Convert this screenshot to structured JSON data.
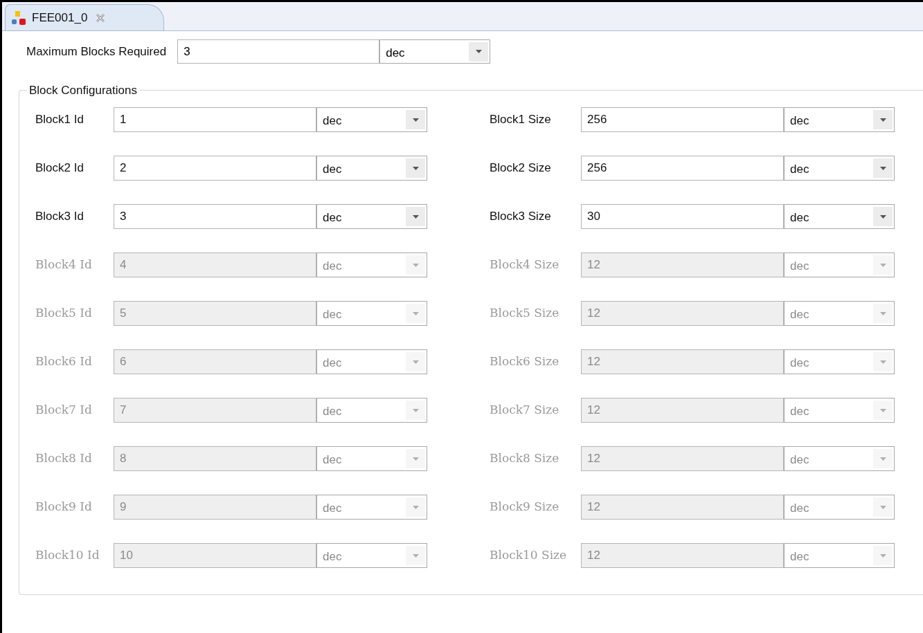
{
  "tab": {
    "title": "FEE001_0",
    "selected": true
  },
  "max_blocks": {
    "label": "Maximum Blocks Required",
    "value": "3",
    "format": "dec"
  },
  "group": {
    "title": "Block Configurations"
  },
  "blocks": [
    {
      "disabled": false,
      "id": {
        "label": "Block1 Id",
        "value": "1",
        "format": "dec"
      },
      "size": {
        "label": "Block1 Size",
        "value": "256",
        "format": "dec"
      }
    },
    {
      "disabled": false,
      "id": {
        "label": "Block2 Id",
        "value": "2",
        "format": "dec"
      },
      "size": {
        "label": "Block2 Size",
        "value": "256",
        "format": "dec"
      }
    },
    {
      "disabled": false,
      "id": {
        "label": "Block3 Id",
        "value": "3",
        "format": "dec"
      },
      "size": {
        "label": "Block3 Size",
        "value": "30",
        "format": "dec"
      }
    },
    {
      "disabled": true,
      "id": {
        "label": "Block4 Id",
        "value": "4",
        "format": "dec"
      },
      "size": {
        "label": "Block4 Size",
        "value": "12",
        "format": "dec"
      }
    },
    {
      "disabled": true,
      "id": {
        "label": "Block5 Id",
        "value": "5",
        "format": "dec"
      },
      "size": {
        "label": "Block5 Size",
        "value": "12",
        "format": "dec"
      }
    },
    {
      "disabled": true,
      "id": {
        "label": "Block6 Id",
        "value": "6",
        "format": "dec"
      },
      "size": {
        "label": "Block6 Size",
        "value": "12",
        "format": "dec"
      }
    },
    {
      "disabled": true,
      "id": {
        "label": "Block7 Id",
        "value": "7",
        "format": "dec"
      },
      "size": {
        "label": "Block7 Size",
        "value": "12",
        "format": "dec"
      }
    },
    {
      "disabled": true,
      "id": {
        "label": "Block8 Id",
        "value": "8",
        "format": "dec"
      },
      "size": {
        "label": "Block8 Size",
        "value": "12",
        "format": "dec"
      }
    },
    {
      "disabled": true,
      "id": {
        "label": "Block9 Id",
        "value": "9",
        "format": "dec"
      },
      "size": {
        "label": "Block9 Size",
        "value": "12",
        "format": "dec"
      }
    },
    {
      "disabled": true,
      "id": {
        "label": "Block10 Id",
        "value": "10",
        "format": "dec"
      },
      "size": {
        "label": "Block10 Size",
        "value": "12",
        "format": "dec"
      }
    }
  ]
}
